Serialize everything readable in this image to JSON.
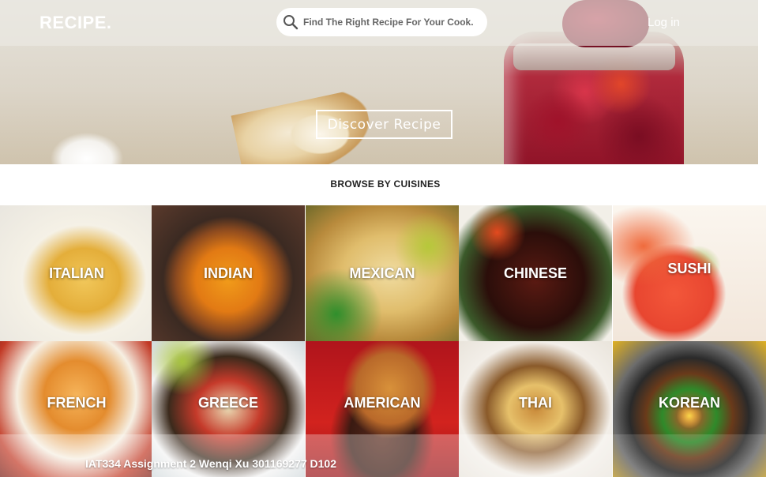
{
  "header": {
    "logo": "RECIPE.",
    "search_placeholder": "Find The Right Recipe For Your Cook.",
    "login_label": "Log in"
  },
  "hero": {
    "cta_label": "Discover Recipe"
  },
  "browse": {
    "title": "BROWSE BY CUISINES",
    "cuisines": [
      "ITALIAN",
      "INDIAN",
      "MEXICAN",
      "CHINESE",
      "SUSHI",
      "FRENCH",
      "GREECE",
      "AMERICAN",
      "THAI",
      "KOREAN"
    ]
  },
  "footer": {
    "text": "IAT334 Assignment 2 Wenqi Xu 301169277 D102"
  },
  "icons": {
    "search": "search-icon"
  }
}
